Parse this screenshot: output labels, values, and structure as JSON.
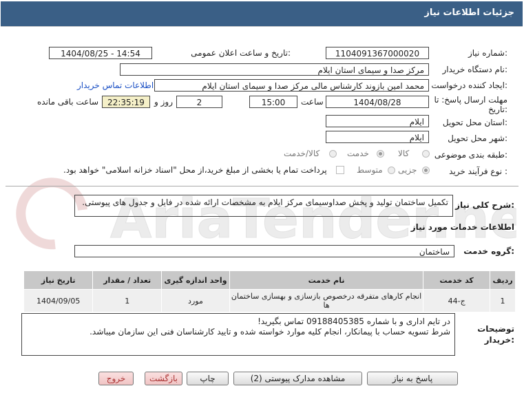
{
  "header": {
    "title": "جزئیات اطلاعات نیاز"
  },
  "form": {
    "need_number_label": "شماره نیاز:",
    "need_number": "1104091367000020",
    "announce_label": "تاریخ و ساعت اعلان عمومی:",
    "announce_value": "1404/08/25 - 14:54",
    "buyer_org_label": "نام دستگاه خریدار:",
    "buyer_org": "مرکز صدا و سیمای استان ایلام",
    "creator_label": "ایجاد کننده درخواست:",
    "creator": "محمد امین بازوند کارشناس مالی مرکز صدا و سیمای استان ایلام",
    "contact_link": "اطلاعات تماس خریدار",
    "deadline_label_1": "مهلت ارسال پاسخ: تا",
    "deadline_label_2": "تاریخ:",
    "deadline_date": "1404/08/28",
    "time_label": "ساعت",
    "deadline_time": "15:00",
    "days_value": "2",
    "days_label": "روز و",
    "remaining_time": "22:35:19",
    "remaining_label": "ساعت باقی مانده",
    "province_label": "استان محل تحویل:",
    "province": "ایلام",
    "city_label": "شهر محل تحویل:",
    "city": "ایلام",
    "category_label": "طبقه بندی موضوعی:",
    "category_options": [
      "کالا",
      "خدمت",
      "کالا/خدمت"
    ],
    "category_selected": "خدمت",
    "process_label": "نوع فرآیند خرید :",
    "process_options": [
      "جزیی",
      "متوسط"
    ],
    "process_selected": "جزیی",
    "payment_text": "پرداخت تمام یا بخشی از مبلغ خرید،از محل \"اسناد خزانه اسلامی\" خواهد بود."
  },
  "description": {
    "label": "شرح کلی نیاز:",
    "text": "تکمیل ساختمان تولید و پخش صداوسیمای مرکز ایلام به مشخصات ارائه شده در فایل و جدول های پیوستی."
  },
  "services_section": {
    "title": "اطلاعات خدمات مورد نیاز",
    "group_label": "گروه خدمت:",
    "group_value": "ساختمان"
  },
  "table": {
    "headers": [
      "ردیف",
      "کد خدمت",
      "نام خدمت",
      "واحد اندازه گیری",
      "تعداد / مقدار",
      "تاریخ نیاز"
    ],
    "rows": [
      [
        "1",
        "ج-44",
        "انجام کارهای متفرقه درخصوص بازسازی و بهسازی ساختمان ها",
        "مورد",
        "1",
        "1404/09/05"
      ]
    ]
  },
  "notes": {
    "label_1": "توضیحات",
    "label_2": "خریدار:",
    "line_1": "در تایم اداری و با شماره 09188405385 تماس بگیرید!",
    "line_2": "شرط تسویه حساب با پیمانکار، انجام کلیه موارد خواسته شده و تایید کارشناسان فنی این سازمان میباشد."
  },
  "buttons": {
    "reply": "پاسخ به نیاز",
    "attachments": "مشاهده مدارک پیوستی (2)",
    "print": "چاپ",
    "back": "بازگشت",
    "exit": "خروج"
  },
  "watermark": {
    "text": "AriaTender.net"
  },
  "colors": {
    "header_bg": "#3a5f86",
    "link": "#1a4fc4",
    "table_header": "#c8c8c8"
  }
}
